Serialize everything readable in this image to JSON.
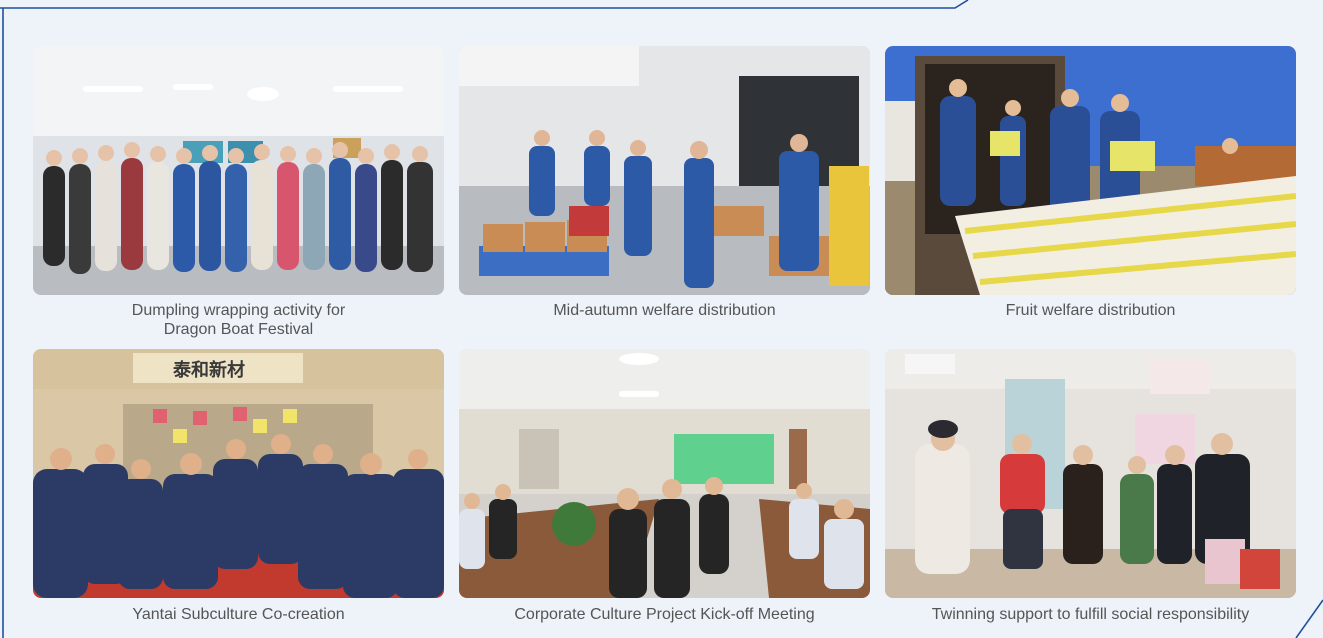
{
  "colors": {
    "background": "#eef3fa",
    "frame_line": "#1f4fa0",
    "caption_text": "#555555"
  },
  "photos": [
    {
      "caption": "Dumpling wrapping activity for\nDragon Boat Festival",
      "scene": "group-photo-indoor"
    },
    {
      "caption": "Mid-autumn welfare distribution",
      "scene": "workers-carrying-boxes"
    },
    {
      "caption": "Fruit welfare distribution",
      "scene": "truck-unloading-fruit"
    },
    {
      "caption": "Yantai Subculture Co-creation",
      "scene": "team-posing-under-sign",
      "sign_text": "泰和新材"
    },
    {
      "caption": "Corporate Culture Project Kick-off Meeting",
      "scene": "conference-room-meeting"
    },
    {
      "caption": "Twinning support to fulfill social responsibility",
      "scene": "home-visit"
    }
  ]
}
